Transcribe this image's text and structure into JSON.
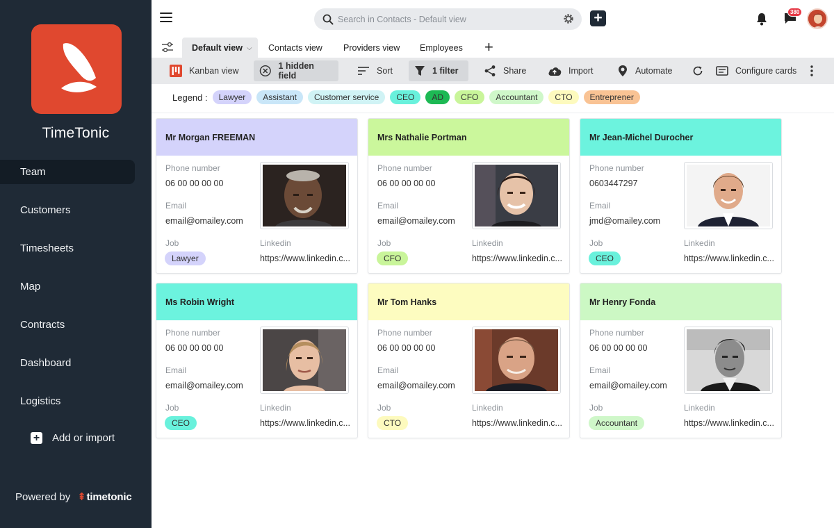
{
  "app": {
    "name": "TimeTonic",
    "powered_by": "Powered by",
    "brand": "timetonic",
    "brand_mark": "⇞"
  },
  "sidebar": {
    "items": [
      {
        "label": "Team",
        "active": true
      },
      {
        "label": "Customers"
      },
      {
        "label": "Timesheets"
      },
      {
        "label": "Map"
      },
      {
        "label": "Contracts"
      },
      {
        "label": "Dashboard"
      },
      {
        "label": "Logistics"
      }
    ],
    "add_import": "Add or import"
  },
  "header": {
    "search_placeholder": "Search in Contacts - Default view",
    "notification_count": "380"
  },
  "tabs": [
    {
      "label": "Default view",
      "active": true
    },
    {
      "label": "Contacts view"
    },
    {
      "label": "Providers view"
    },
    {
      "label": "Employees"
    }
  ],
  "toolbar": {
    "kanban": "Kanban view",
    "hidden": "1 hidden field",
    "sort": "Sort",
    "filter": "1 filter",
    "share": "Share",
    "import": "Import",
    "automate": "Automate",
    "configure": "Configure cards"
  },
  "legend": {
    "label": "Legend :",
    "chips": [
      {
        "label": "Lawyer",
        "color": "#d4d3fb"
      },
      {
        "label": "Assistant",
        "color": "#c9e6f8"
      },
      {
        "label": "Customer service",
        "color": "#d0f3f5"
      },
      {
        "label": "CEO",
        "color": "#69f1dc"
      },
      {
        "label": "AD",
        "color": "#1db954"
      },
      {
        "label": "CFO",
        "color": "#c9f59a"
      },
      {
        "label": "Accountant",
        "color": "#cff7c9"
      },
      {
        "label": "CTO",
        "color": "#fdfabe"
      },
      {
        "label": "Entreprener",
        "color": "#f9c394"
      }
    ]
  },
  "fields": {
    "phone": "Phone number",
    "email": "Email",
    "job": "Job",
    "linkedin": "Linkedin"
  },
  "cards": [
    {
      "name": "Mr Morgan FREEMAN",
      "phone": "06 00 00 00 00",
      "email": "email@omailey.com",
      "job": "Lawyer",
      "linkedin": "https://www.linkedin.c...",
      "header_color": "#d4d3fb",
      "job_color": "#d4d3fb"
    },
    {
      "name": "Mrs Nathalie Portman",
      "phone": "06 00 00 00 00",
      "email": "email@omailey.com",
      "job": "CFO",
      "linkedin": "https://www.linkedin.c...",
      "header_color": "#cbf79c",
      "job_color": "#c9f59a"
    },
    {
      "name": "Mr Jean-Michel Durocher",
      "phone": "0603447297",
      "email": "jmd@omailey.com",
      "job": "CEO",
      "linkedin": "https://www.linkedin.c...",
      "header_color": "#6cf3de",
      "job_color": "#69f1dc"
    },
    {
      "name": "Ms Robin Wright",
      "phone": "06 00 00 00 00",
      "email": "email@omailey.com",
      "job": "CEO",
      "linkedin": "https://www.linkedin.c...",
      "header_color": "#6cf3de",
      "job_color": "#69f1dc"
    },
    {
      "name": "Mr Tom Hanks",
      "phone": "06 00 00 00 00",
      "email": "email@omailey.com",
      "job": "CTO",
      "linkedin": "https://www.linkedin.c...",
      "header_color": "#fdfcc0",
      "job_color": "#fdfabe"
    },
    {
      "name": "Mr Henry Fonda",
      "phone": "06 00 00 00 00",
      "email": "email@omailey.com",
      "job": "Accountant",
      "linkedin": "https://www.linkedin.c...",
      "header_color": "#ccf8c4",
      "job_color": "#cff7c9"
    }
  ]
}
